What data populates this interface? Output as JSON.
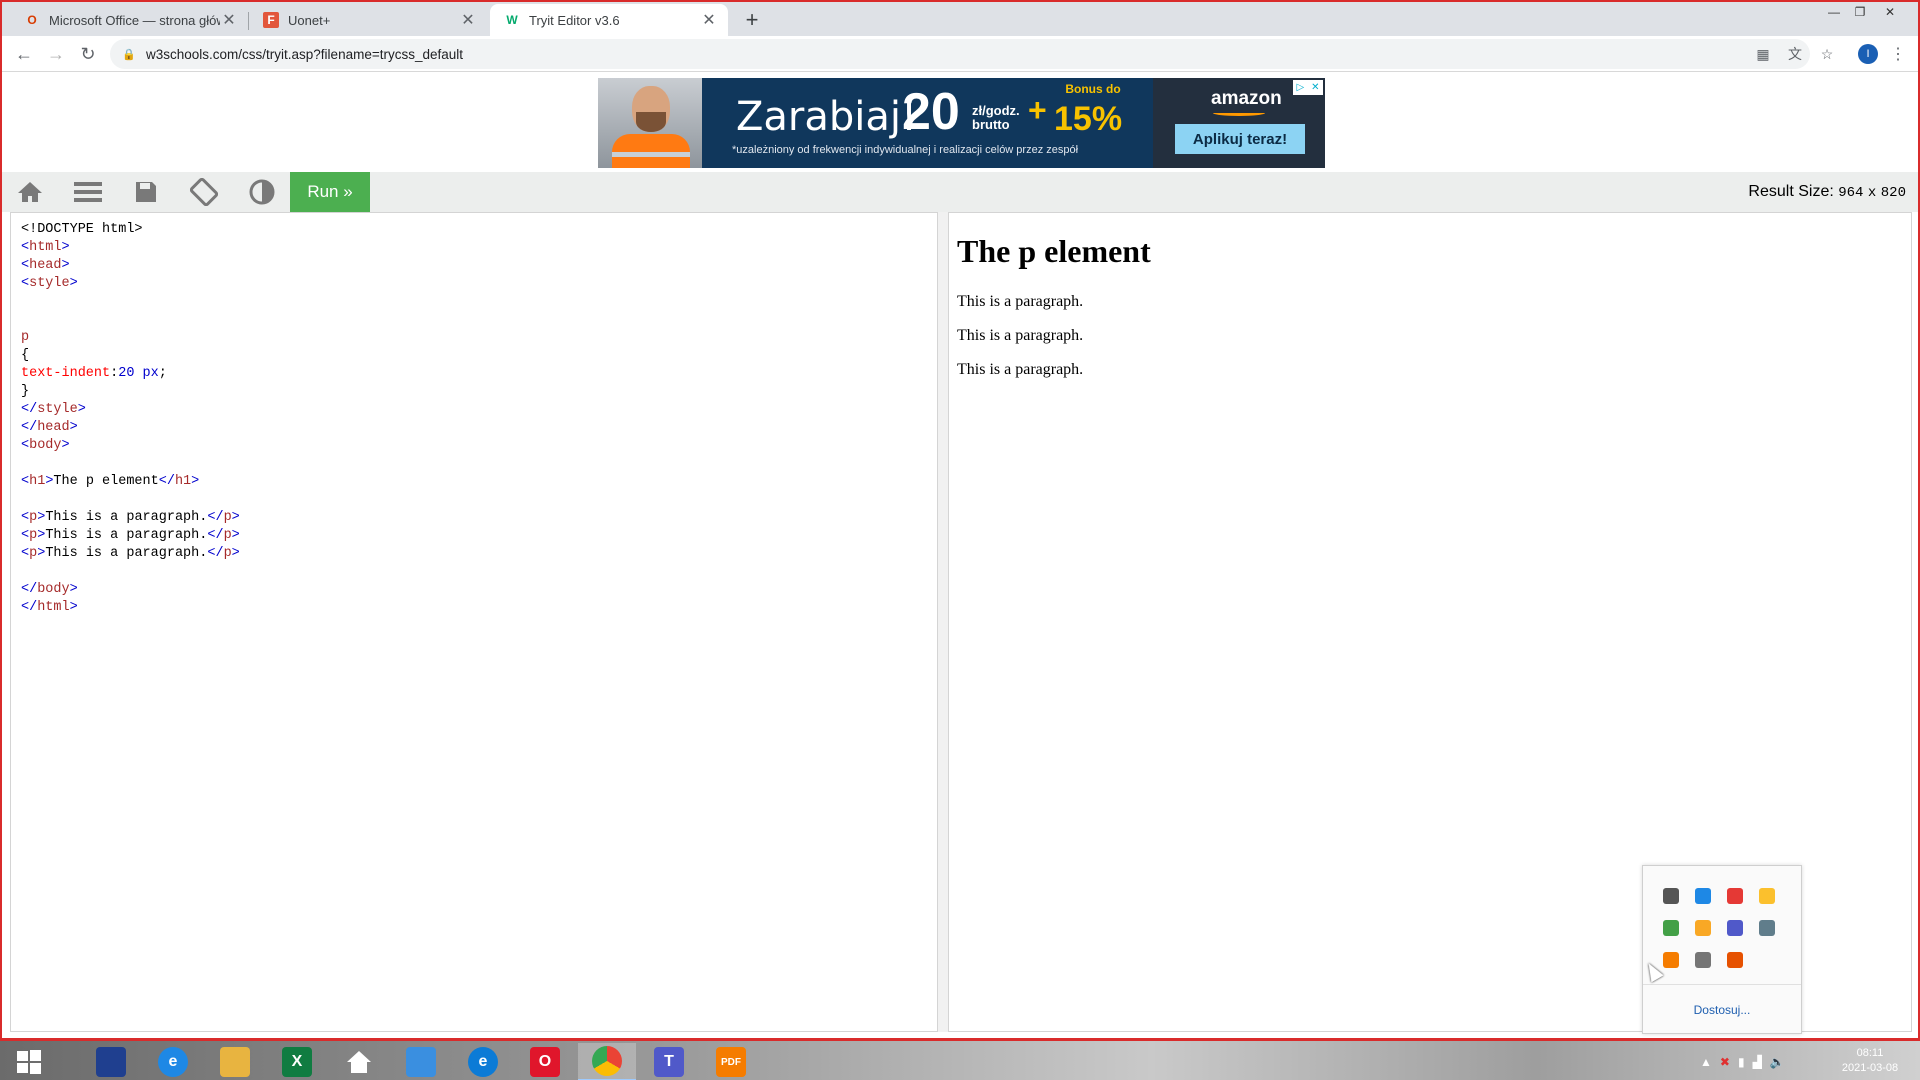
{
  "browser": {
    "tabs": [
      {
        "title": "Microsoft Office — strona główna",
        "favicon_color": "#d83b01",
        "favicon_glyph": "O"
      },
      {
        "title": "Uonet+",
        "favicon_color": "#e2563b",
        "favicon_glyph": "F"
      },
      {
        "title": "Tryit Editor v3.6",
        "favicon_color": "#04aa6d",
        "favicon_glyph": "W"
      }
    ],
    "new_tab_glyph": "+",
    "url": "w3schools.com/css/tryit.asp?filename=trycss_default",
    "profile_initial": "I"
  },
  "ad": {
    "headline": "Zarabiaj!",
    "amount": "20",
    "unit": "zł/godz. brutto",
    "bonus_plus": "+",
    "bonus_label": "Bonus do",
    "bonus_value": "15%",
    "note": "*uzależniony od frekwencji indywidualnej i realizacji celów przez zespół",
    "brand": "amazon",
    "cta": "Aplikuj teraz!",
    "colors": {
      "bg": "#10375c",
      "accent": "#f8c200",
      "cta_bg": "#8cd3f3"
    }
  },
  "tryit": {
    "icons": [
      "home-icon",
      "menu-icon",
      "save-icon",
      "rotate-icon",
      "contrast-icon"
    ],
    "run_label": "Run »",
    "result_size_label": "Result Size:",
    "result_width": "964",
    "result_x": "x",
    "result_height": "820",
    "run_color": "#4caf50"
  },
  "code_lines": [
    {
      "parts": [
        {
          "t": "<!DOCTYPE html>",
          "c": "plain"
        }
      ]
    },
    {
      "parts": [
        {
          "t": "<",
          "c": "tag"
        },
        {
          "t": "html",
          "c": "tname"
        },
        {
          "t": ">",
          "c": "tag"
        }
      ]
    },
    {
      "parts": [
        {
          "t": "<",
          "c": "tag"
        },
        {
          "t": "head",
          "c": "tname"
        },
        {
          "t": ">",
          "c": "tag"
        }
      ]
    },
    {
      "parts": [
        {
          "t": "<",
          "c": "tag"
        },
        {
          "t": "style",
          "c": "tname"
        },
        {
          "t": ">",
          "c": "tag"
        }
      ]
    },
    {
      "parts": []
    },
    {
      "parts": []
    },
    {
      "parts": [
        {
          "t": "p",
          "c": "sel"
        }
      ]
    },
    {
      "parts": [
        {
          "t": "{",
          "c": "plain"
        }
      ]
    },
    {
      "parts": [
        {
          "t": "text-indent",
          "c": "prop"
        },
        {
          "t": ":",
          "c": "plain"
        },
        {
          "t": "20 px",
          "c": "val"
        },
        {
          "t": ";",
          "c": "plain"
        }
      ]
    },
    {
      "parts": [
        {
          "t": "}",
          "c": "plain"
        }
      ]
    },
    {
      "parts": [
        {
          "t": "</",
          "c": "tag"
        },
        {
          "t": "style",
          "c": "tname"
        },
        {
          "t": ">",
          "c": "tag"
        }
      ]
    },
    {
      "parts": [
        {
          "t": "</",
          "c": "tag"
        },
        {
          "t": "head",
          "c": "tname"
        },
        {
          "t": ">",
          "c": "tag"
        }
      ]
    },
    {
      "parts": [
        {
          "t": "<",
          "c": "tag"
        },
        {
          "t": "body",
          "c": "tname"
        },
        {
          "t": ">",
          "c": "tag"
        }
      ]
    },
    {
      "parts": []
    },
    {
      "parts": [
        {
          "t": "<",
          "c": "tag"
        },
        {
          "t": "h1",
          "c": "tname"
        },
        {
          "t": ">",
          "c": "tag"
        },
        {
          "t": "The p element",
          "c": "plain"
        },
        {
          "t": "</",
          "c": "tag"
        },
        {
          "t": "h1",
          "c": "tname"
        },
        {
          "t": ">",
          "c": "tag"
        }
      ]
    },
    {
      "parts": []
    },
    {
      "parts": [
        {
          "t": "<",
          "c": "tag"
        },
        {
          "t": "p",
          "c": "tname"
        },
        {
          "t": ">",
          "c": "tag"
        },
        {
          "t": "This is a paragraph.",
          "c": "plain"
        },
        {
          "t": "</",
          "c": "tag"
        },
        {
          "t": "p",
          "c": "tname"
        },
        {
          "t": ">",
          "c": "tag"
        }
      ]
    },
    {
      "parts": [
        {
          "t": "<",
          "c": "tag"
        },
        {
          "t": "p",
          "c": "tname"
        },
        {
          "t": ">",
          "c": "tag"
        },
        {
          "t": "This is a paragraph.",
          "c": "plain"
        },
        {
          "t": "</",
          "c": "tag"
        },
        {
          "t": "p",
          "c": "tname"
        },
        {
          "t": ">",
          "c": "tag"
        }
      ]
    },
    {
      "parts": [
        {
          "t": "<",
          "c": "tag"
        },
        {
          "t": "p",
          "c": "tname"
        },
        {
          "t": ">",
          "c": "tag"
        },
        {
          "t": "This is a paragraph.",
          "c": "plain"
        },
        {
          "t": "</",
          "c": "tag"
        },
        {
          "t": "p",
          "c": "tname"
        },
        {
          "t": ">",
          "c": "tag"
        }
      ]
    },
    {
      "parts": []
    },
    {
      "parts": [
        {
          "t": "</",
          "c": "tag"
        },
        {
          "t": "body",
          "c": "tname"
        },
        {
          "t": ">",
          "c": "tag"
        }
      ]
    },
    {
      "parts": [
        {
          "t": "</",
          "c": "tag"
        },
        {
          "t": "html",
          "c": "tname"
        },
        {
          "t": ">",
          "c": "tag"
        }
      ]
    }
  ],
  "result": {
    "heading": "The p element",
    "paragraphs": [
      "This is a paragraph.",
      "This is a paragraph.",
      "This is a paragraph."
    ]
  },
  "tray_popup": {
    "icons": [
      "monitor-icon",
      "network-icon",
      "paint-icon",
      "green-circle-icon",
      "shield-icon",
      "cube-icon",
      "teams-icon",
      "usb-icon",
      "pdf-tool-icon",
      "printer-icon",
      "archive-icon"
    ],
    "customize_label": "Dostosuj..."
  },
  "taskbar": {
    "apps": [
      {
        "name": "start-icon",
        "color": "#ffffff",
        "glyph": ""
      },
      {
        "name": "lenovo-icon",
        "color": "#1f3f8f",
        "glyph": ""
      },
      {
        "name": "internet-explorer-icon",
        "color": "#1e88e5",
        "glyph": "e"
      },
      {
        "name": "file-explorer-icon",
        "color": "#e8b440",
        "glyph": ""
      },
      {
        "name": "excel-icon",
        "color": "#107c41",
        "glyph": "X"
      },
      {
        "name": "home-app-icon",
        "color": "#ffffff",
        "glyph": ""
      },
      {
        "name": "mail-icon",
        "color": "#3a8fe0",
        "glyph": ""
      },
      {
        "name": "edge-icon",
        "color": "#0c7bd6",
        "glyph": "e"
      },
      {
        "name": "opera-icon",
        "color": "#e0162b",
        "glyph": "O"
      },
      {
        "name": "chrome-icon",
        "color": "#f4b400",
        "glyph": ""
      },
      {
        "name": "teams-icon",
        "color": "#5059c9",
        "glyph": "T"
      },
      {
        "name": "pdf-app-icon",
        "color": "#f57c00",
        "glyph": "PDF"
      }
    ],
    "time": "08:11",
    "date": "2021-03-08"
  }
}
